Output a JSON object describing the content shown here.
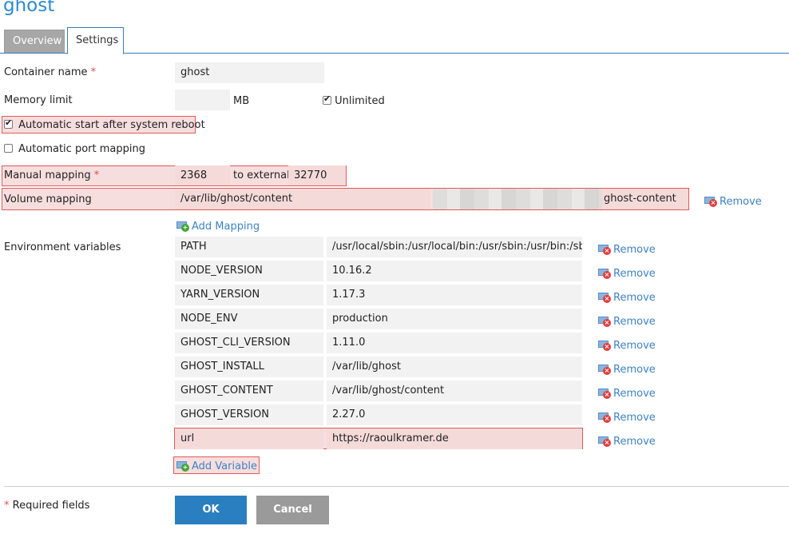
{
  "page": {
    "title": "ghost"
  },
  "tabs": [
    {
      "label": "Overview"
    },
    {
      "label": "Settings"
    }
  ],
  "form": {
    "container_name": {
      "label": "Container name",
      "required": "*",
      "value": "ghost"
    },
    "memory_limit": {
      "label": "Memory limit",
      "value": "",
      "unit": "MB",
      "unlimited_label": "Unlimited",
      "unlimited_checked": true
    },
    "auto_start": {
      "label": "Automatic start after system reboot",
      "checked": true
    },
    "auto_port": {
      "label": "Automatic port mapping",
      "checked": false
    },
    "manual_mapping": {
      "label": "Manual mapping",
      "required": "*",
      "internal": "2368",
      "to_external_label": "to external",
      "external": "32770"
    },
    "volume_mapping": {
      "label": "Volume mapping",
      "path": "/var/lib/ghost/content",
      "name": "ghost-content",
      "remove_label": "Remove"
    },
    "add_mapping_label": "Add Mapping",
    "env": {
      "label": "Environment variables",
      "rows": [
        {
          "key": "PATH",
          "value": "/usr/local/sbin:/usr/local/bin:/usr/sbin:/usr/bin:/sbi",
          "remove": "Remove"
        },
        {
          "key": "NODE_VERSION",
          "value": "10.16.2",
          "remove": "Remove"
        },
        {
          "key": "YARN_VERSION",
          "value": "1.17.3",
          "remove": "Remove"
        },
        {
          "key": "NODE_ENV",
          "value": "production",
          "remove": "Remove"
        },
        {
          "key": "GHOST_CLI_VERSION",
          "value": "1.11.0",
          "remove": "Remove"
        },
        {
          "key": "GHOST_INSTALL",
          "value": "/var/lib/ghost",
          "remove": "Remove"
        },
        {
          "key": "GHOST_CONTENT",
          "value": "/var/lib/ghost/content",
          "remove": "Remove"
        },
        {
          "key": "GHOST_VERSION",
          "value": "2.27.0",
          "remove": "Remove"
        },
        {
          "key": "url",
          "value": "https://raoulkramer.de",
          "remove": "Remove"
        }
      ],
      "add_label": "Add Variable"
    },
    "required_note": {
      "star": "*",
      "text": "Required fields"
    },
    "ok_label": "OK",
    "cancel_label": "Cancel"
  },
  "colors": {
    "accent": "#2a8ad2",
    "highlight": "#e05a5a",
    "ok": "#2a7fc1",
    "cancel": "#9a9a9a"
  },
  "icons": {
    "remove": "remove-icon",
    "add": "add-icon"
  }
}
